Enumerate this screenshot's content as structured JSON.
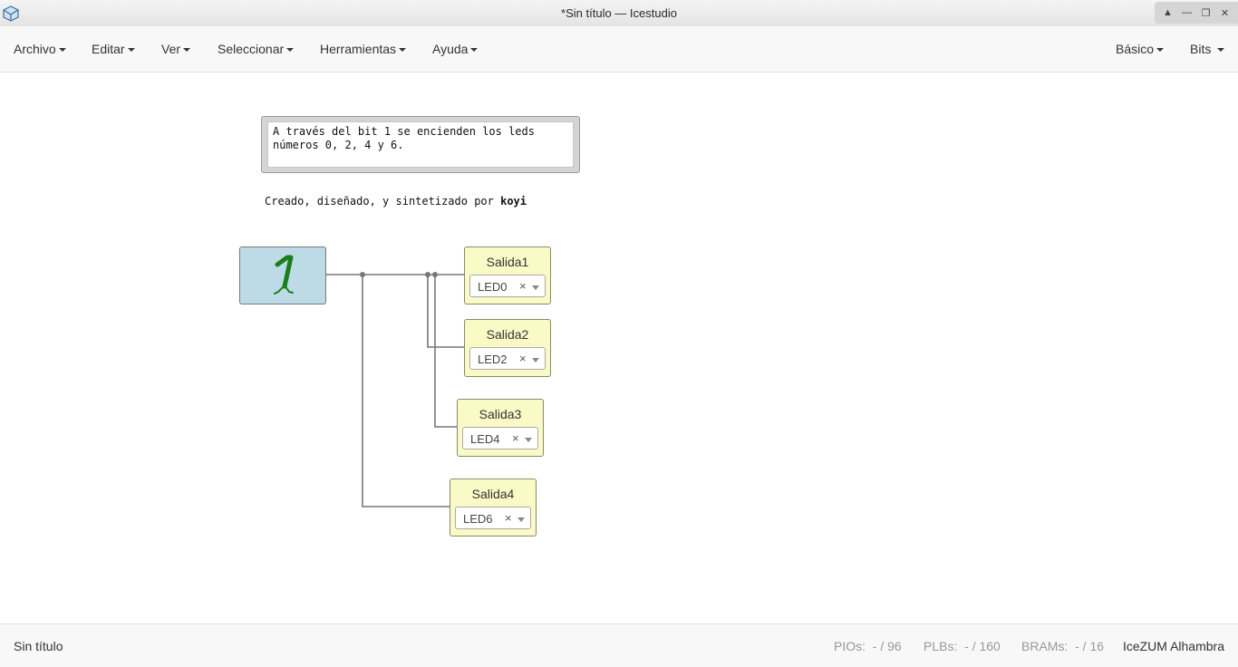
{
  "window": {
    "title": "*Sin título — Icestudio"
  },
  "menu": {
    "left": [
      "Archivo",
      "Editar",
      "Ver",
      "Seleccionar",
      "Herramientas",
      "Ayuda"
    ],
    "right": [
      "Básico",
      "Bits"
    ]
  },
  "canvas": {
    "comment": "A través del bit 1 se encienden los leds\nnúmeros 0, 2, 4 y 6.",
    "credit_prefix": "Creado, diseñado, y sintetizado por ",
    "credit_author": "koyi",
    "constant_value": "1",
    "outputs": [
      {
        "name": "Salida1",
        "pin": "LED0"
      },
      {
        "name": "Salida2",
        "pin": "LED2"
      },
      {
        "name": "Salida3",
        "pin": "LED4"
      },
      {
        "name": "Salida4",
        "pin": "LED6"
      }
    ],
    "pin_clear_symbol": "×"
  },
  "status": {
    "file": "Sin título",
    "pios_label": "PIOs:",
    "pios_value": "- / 96",
    "plbs_label": "PLBs:",
    "plbs_value": "- / 160",
    "brams_label": "BRAMs:",
    "brams_value": "- / 16",
    "board": "IceZUM Alhambra"
  },
  "colors": {
    "constant_block": "#bddbe7",
    "output_block": "#fafac6",
    "digit_green": "#1a7f1a",
    "wire": "#777777"
  }
}
